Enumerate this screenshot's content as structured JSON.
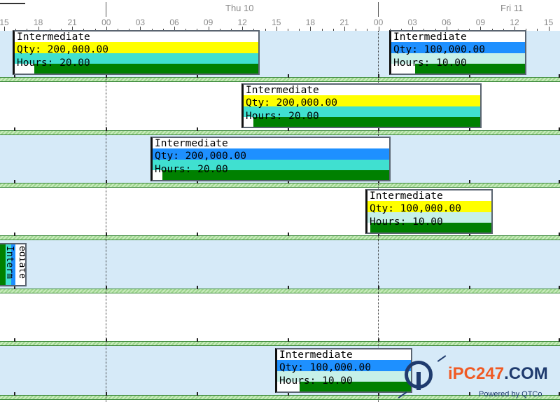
{
  "header": {
    "days": [
      {
        "label": "Thu 10"
      },
      {
        "label": "Fri 11"
      }
    ],
    "hour_labels": [
      "15",
      "18",
      "21",
      "00",
      "03",
      "06",
      "09",
      "12",
      "15",
      "18",
      "21",
      "00",
      "03",
      "06",
      "09",
      "12",
      "15"
    ]
  },
  "colors": {
    "row_blue": "#d6eaf8",
    "separator_green": "#9fd58f",
    "yellow": "#ffff00",
    "turquoise": "#40e0d0",
    "dark_green": "#008000",
    "blue": "#1e90ff",
    "light_blue": "#c6f0e8"
  },
  "bars": [
    {
      "name": "Intermediate",
      "qty": "Qty: 200,000.00",
      "hours": "Hours: 20.00",
      "top": "yellow",
      "progress": 0.08
    },
    {
      "name": "Intermediate",
      "qty": "Qty: 100,000.00",
      "hours": "Hours: 10.00",
      "top": "blue",
      "progress": 0.18
    },
    {
      "name": "Intermediate",
      "qty": "Qty: 200,000.00",
      "hours": "Hours: 20.00",
      "top": "yellow",
      "progress": 0.04
    },
    {
      "name": "Intermediate",
      "qty": "Qty: 200,000.00",
      "hours": "Hours: 20.00",
      "top": "blue",
      "progress": 0.04
    },
    {
      "name": "Intermediate",
      "qty": "Qty: 100,000.00",
      "hours": "Hours: 10.00",
      "top": "yellow",
      "progress": 0.02
    },
    {
      "name": "Intermediate",
      "qty": "Qty: 100,000.00",
      "hours": "Hours: 10.00",
      "top": "blue",
      "progress": 0.17
    }
  ],
  "vertical_bar": {
    "label": "Interm",
    "label2": "ediate"
  },
  "watermark": {
    "brand": "iPC247",
    "brand_suffix": ".COM",
    "tagline": "Powered by QTCo"
  }
}
